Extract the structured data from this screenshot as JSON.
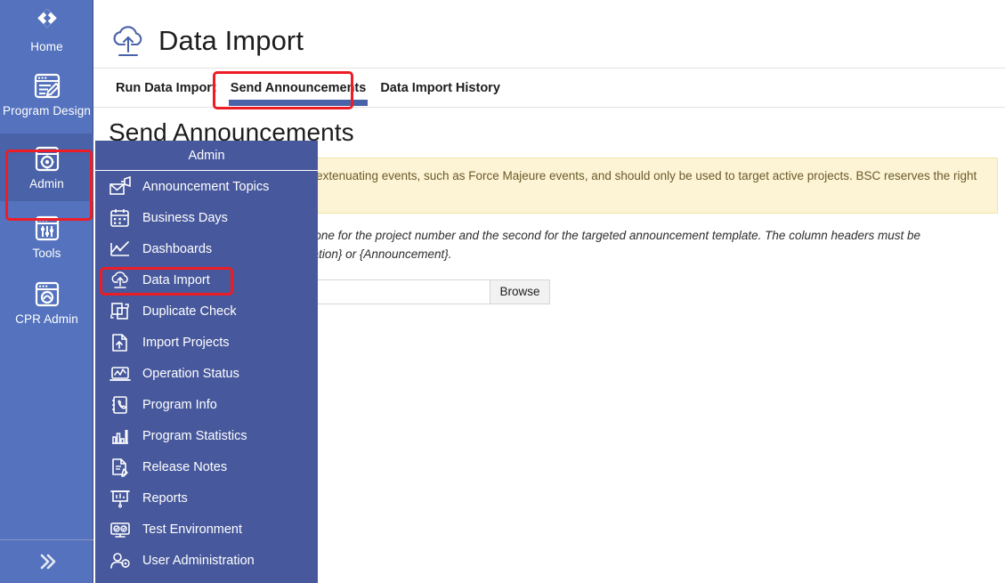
{
  "colors": {
    "sidebar_bg": "#5472bd",
    "sidebar_active_bg": "#4a63a8",
    "flyout_bg": "#47589c",
    "accent": "#4a63a8",
    "annotation_red": "#ee1c25",
    "warning_bg": "#fcf4d4",
    "warning_border": "#f3e3a8",
    "warning_text": "#6b5a2b"
  },
  "sidebar": {
    "items": [
      {
        "label": "Home",
        "icon": "home-ring-icon",
        "active": false
      },
      {
        "label": "Program Design",
        "icon": "program-design-icon",
        "active": false
      },
      {
        "label": "Admin",
        "icon": "admin-gear-window-icon",
        "active": true
      },
      {
        "label": "Tools",
        "icon": "tools-sliders-icon",
        "active": false
      },
      {
        "label": "CPR Admin",
        "icon": "cpr-admin-icon",
        "active": false
      }
    ],
    "expand_button": {
      "icon": "double-chevron-right-icon",
      "label": "»"
    }
  },
  "header": {
    "icon": "cloud-upload-icon",
    "title": "Data Import"
  },
  "tabs": [
    {
      "label": "Run Data Import",
      "active": false,
      "highlighted": false
    },
    {
      "label": "Send Announcements",
      "active": true,
      "highlighted": true
    },
    {
      "label": "Data Import History",
      "active": false,
      "highlighted": false
    }
  ],
  "content": {
    "section_title": "Send Announcements",
    "warning": "This feature is intended to be used in extenuating events, such as Force Majeure events, and should only be used to target active projects. BSC reserves the right to revoke this privilege.",
    "note": "The file must contain two columns only, one for the project number and the second for the targeted announcement template. The column headers must be {ProjectNumber} and either {Communication} or {Announcement}.",
    "file_input": {
      "value": "",
      "placeholder": "",
      "browse_label": "Browse"
    }
  },
  "flyout": {
    "title": "Admin",
    "items": [
      {
        "label": "Announcement Topics",
        "icon": "announcement-envelope-icon",
        "highlighted": false
      },
      {
        "label": "Business Days",
        "icon": "calendar-icon",
        "highlighted": false
      },
      {
        "label": "Dashboards",
        "icon": "line-chart-icon",
        "highlighted": false
      },
      {
        "label": "Data Import",
        "icon": "cloud-upload-icon",
        "highlighted": true
      },
      {
        "label": "Duplicate Check",
        "icon": "duplicate-squares-icon",
        "highlighted": false
      },
      {
        "label": "Import Projects",
        "icon": "import-document-icon",
        "highlighted": false
      },
      {
        "label": "Operation Status",
        "icon": "laptop-status-icon",
        "highlighted": false
      },
      {
        "label": "Program Info",
        "icon": "phone-book-icon",
        "highlighted": false
      },
      {
        "label": "Program Statistics",
        "icon": "bar-chart-icon",
        "highlighted": false
      },
      {
        "label": "Release Notes",
        "icon": "document-pencil-icon",
        "highlighted": false
      },
      {
        "label": "Reports",
        "icon": "presentation-board-icon",
        "highlighted": false
      },
      {
        "label": "Test Environment",
        "icon": "test-monitor-icon",
        "highlighted": false
      },
      {
        "label": "User Administration",
        "icon": "user-gear-icon",
        "highlighted": false
      }
    ]
  }
}
